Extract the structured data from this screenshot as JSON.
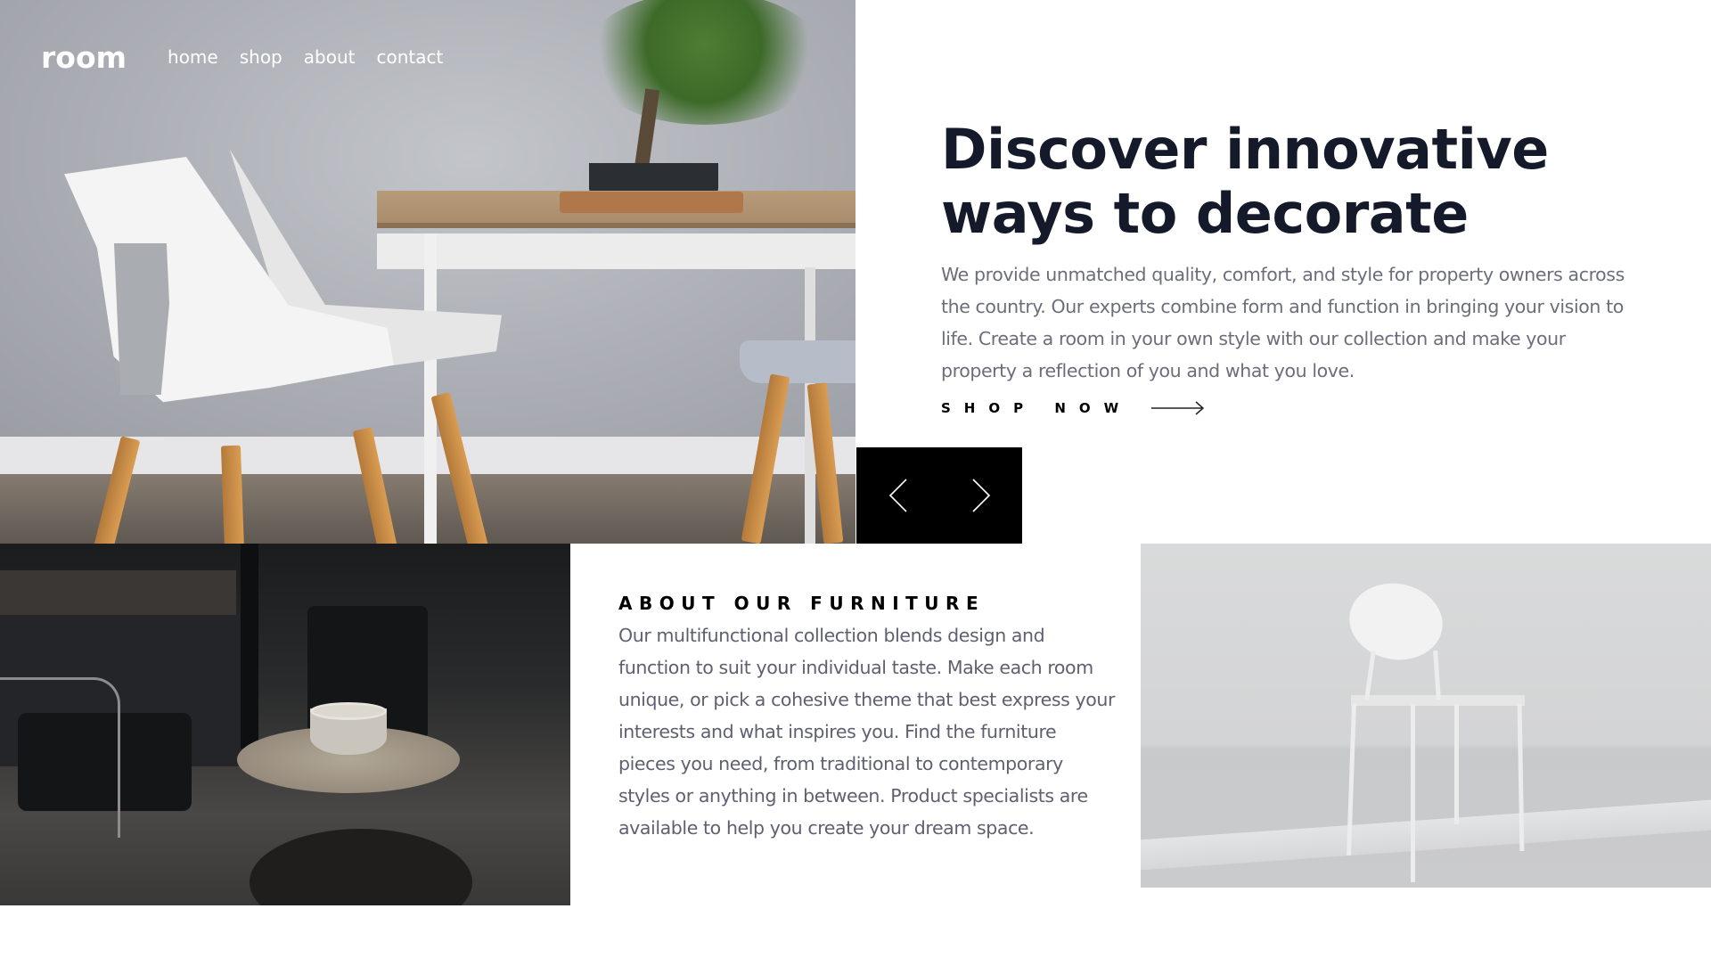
{
  "nav": {
    "logo": "room",
    "links": [
      "home",
      "shop",
      "about",
      "contact"
    ]
  },
  "hero": {
    "headline_line1": "Discover innovative",
    "headline_line2": "ways to decorate",
    "body": "We provide unmatched quality, comfort, and style for property owners across the country. Our experts combine form and function in bringing your vision to life. Create a room in your own style with our collection and make your property a reflection of you and what you love.",
    "cta_label": "SHOP NOW",
    "cta_icon": "arrow-right-icon"
  },
  "slider": {
    "prev_icon": "chevron-left-icon",
    "next_icon": "chevron-right-icon"
  },
  "about": {
    "title": "ABOUT OUR FURNITURE",
    "body": "Our multifunctional collection blends design and function to suit your individual taste. Make each room unique, or pick a cohesive theme that best express your interests and what inspires you. Find the furniture pieces you need, from traditional to contemporary styles or anything in between. Product specialists are available to help you create your dream space."
  },
  "colors": {
    "headline": "#141a2a",
    "body_text": "#6b6e7a",
    "slider_bg": "#000000",
    "accent": "#000000"
  }
}
